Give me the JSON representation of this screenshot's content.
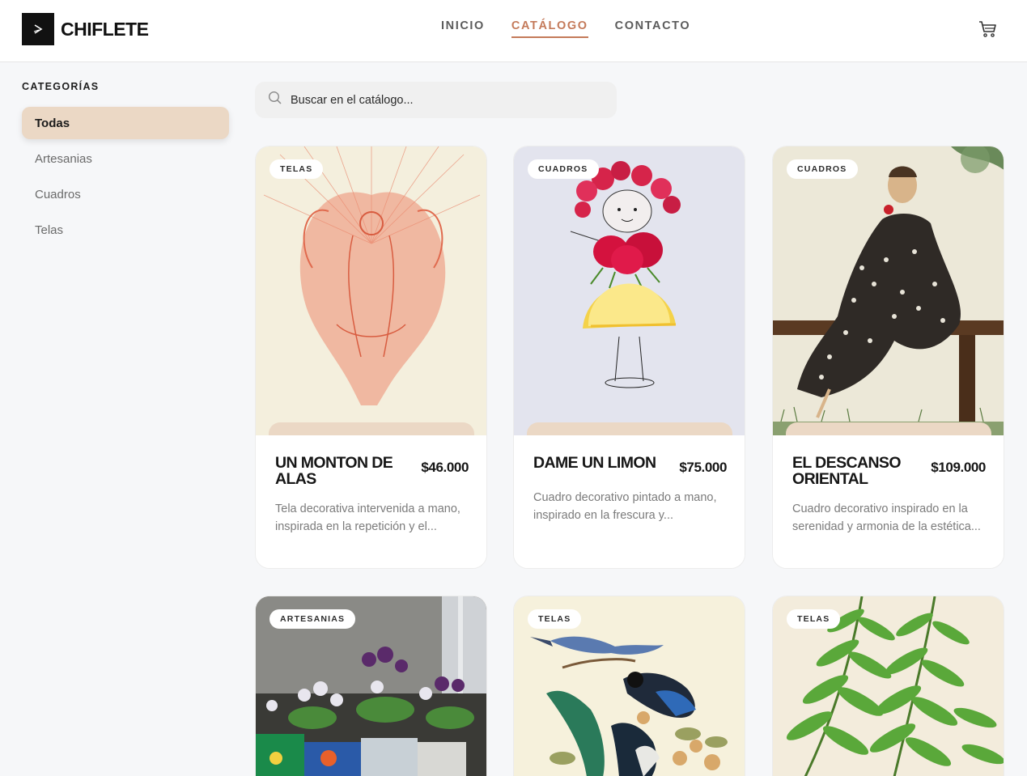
{
  "brand": {
    "name": "CHIFLETE"
  },
  "nav": {
    "items": [
      {
        "label": "INICIO"
      },
      {
        "label": "CATÁLOGO"
      },
      {
        "label": "CONTACTO"
      }
    ],
    "active_index": 1,
    "cart_icon": "cart-icon"
  },
  "sidebar": {
    "title": "CATEGORÍAS",
    "items": [
      {
        "label": "Todas"
      },
      {
        "label": "Artesanias"
      },
      {
        "label": "Cuadros"
      },
      {
        "label": "Telas"
      }
    ],
    "active_index": 0
  },
  "search": {
    "placeholder": "Buscar en el catálogo...",
    "icon": "search-icon"
  },
  "products": [
    {
      "category": "TELAS",
      "name": "UN MONTON DE ALAS",
      "price": "$46.000",
      "description": "Tela decorativa intervenida a mano, inspirada en la repetición y el..."
    },
    {
      "category": "CUADROS",
      "name": "DAME UN LIMON",
      "price": "$75.000",
      "description": "Cuadro decorativo pintado a mano, inspirado en la frescura y..."
    },
    {
      "category": "CUADROS",
      "name": "EL DESCANSO ORIENTAL",
      "price": "$109.000",
      "description": "Cuadro decorativo inspirado en la serenidad y armonia de la estética..."
    },
    {
      "category": "ARTESANIAS",
      "name": "",
      "price": "",
      "description": ""
    },
    {
      "category": "TELAS",
      "name": "",
      "price": "",
      "description": ""
    },
    {
      "category": "TELAS",
      "name": "",
      "price": "",
      "description": ""
    }
  ],
  "colors": {
    "accent": "#c47a5a",
    "active_bg": "#ebd8c5",
    "page_bg": "#f6f7f9"
  }
}
